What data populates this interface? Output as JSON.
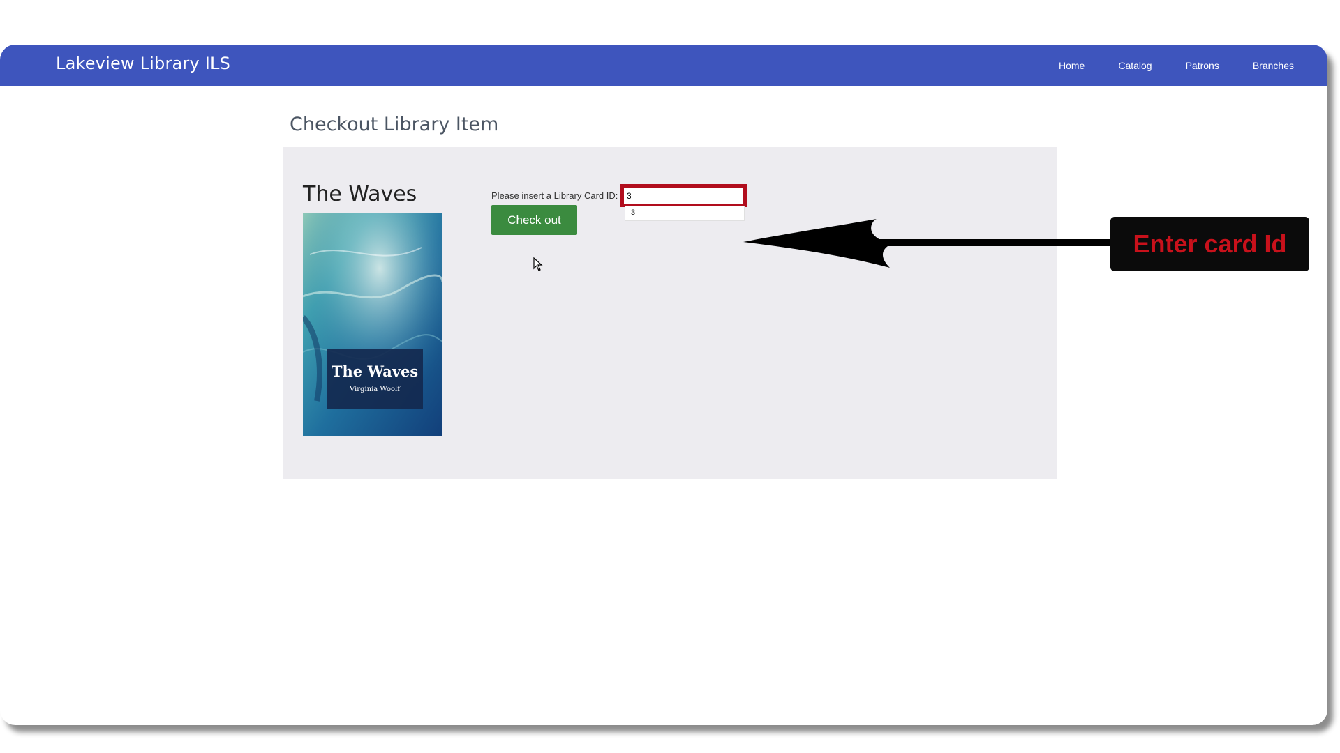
{
  "app": {
    "brand": "Lakeview Library ILS"
  },
  "nav": {
    "items": [
      {
        "label": "Home"
      },
      {
        "label": "Catalog"
      },
      {
        "label": "Patrons"
      },
      {
        "label": "Branches"
      }
    ]
  },
  "page": {
    "title": "Checkout Library Item"
  },
  "item": {
    "title": "The Waves",
    "cover": {
      "title": "The Waves",
      "author": "Virginia Woolf"
    }
  },
  "checkout_form": {
    "card_label": "Please insert a Library Card ID:",
    "card_value": "3",
    "autocomplete_options": [
      "3"
    ],
    "submit_label": "Check out"
  },
  "annotation": {
    "callout_text": "Enter card Id"
  },
  "colors": {
    "navbar": "#3e55bd",
    "panel": "#edecf0",
    "button": "#3b8b3f",
    "highlight_border": "#b10d1d",
    "callout_bg": "#0b0b0b",
    "callout_text": "#c8111b"
  }
}
